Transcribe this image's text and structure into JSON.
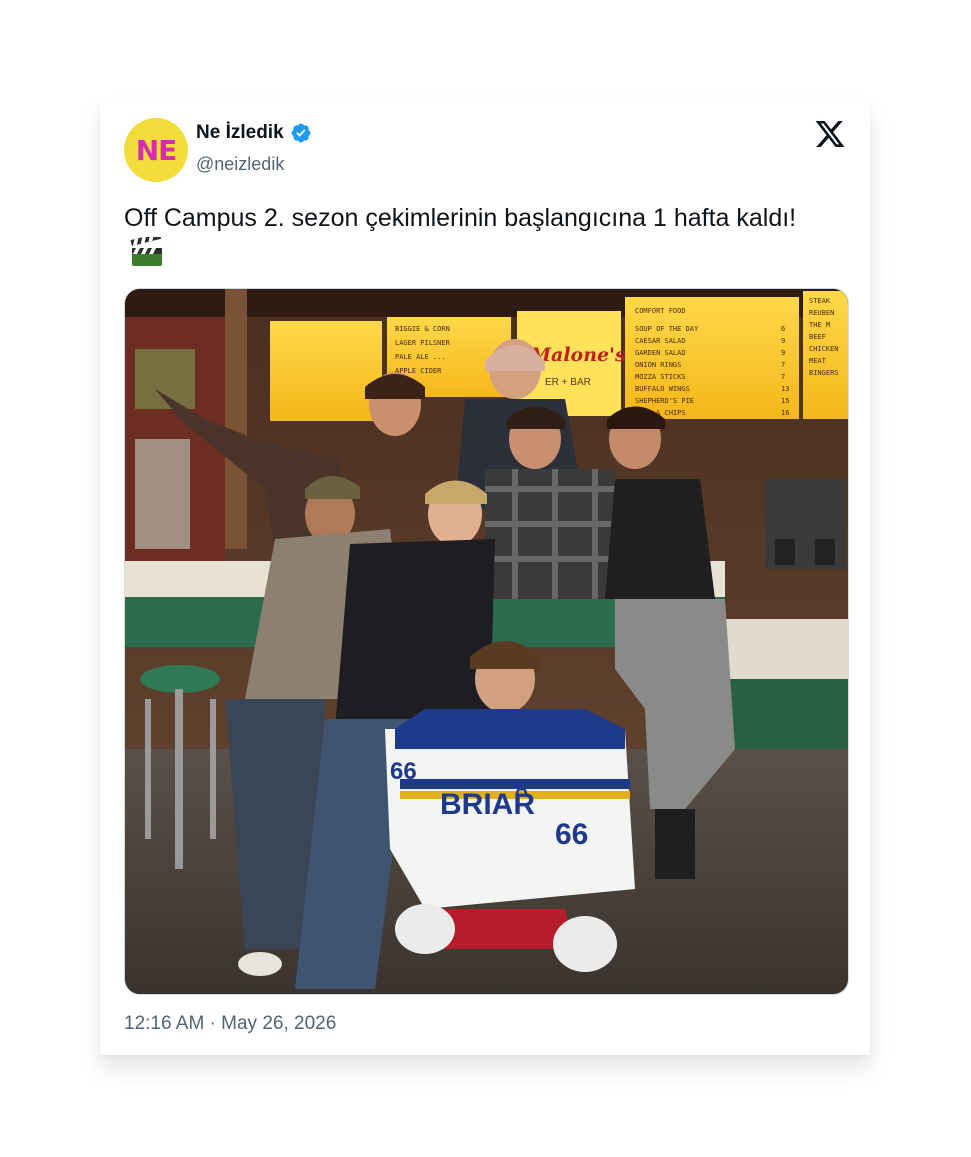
{
  "tweet": {
    "author": {
      "name": "Ne İzledik",
      "handle": "@neizledik",
      "avatar_text": "NE",
      "verified": true
    },
    "text": "Off Campus 2. sezon çekimlerinin başlangıcına 1 hafta kaldı!",
    "emoji": "clapper-board",
    "timestamp": "12:16 AM · May 26, 2026"
  },
  "photo": {
    "menu_left": [
      "BIGGIE & CORN",
      "LAGER PILSNER",
      "PALE ALE ...",
      "APPLE CIDER"
    ],
    "menu_sign": "Malone's",
    "menu_sign_sub": "ER + BAR",
    "menu_board_title": "COMFORT FOOD",
    "menu_board_items": [
      {
        "item": "SOUP OF THE DAY",
        "price": "6"
      },
      {
        "item": "CAESAR SALAD",
        "price": "9"
      },
      {
        "item": "GARDEN SALAD",
        "price": "9"
      },
      {
        "item": "ONION RINGS",
        "price": "7"
      },
      {
        "item": "MOZZA STICKS",
        "price": "7"
      },
      {
        "item": "BUFFALO WINGS",
        "price": "13"
      },
      {
        "item": "SHEPHERD'S PIE",
        "price": "15"
      },
      {
        "item": "FISH & CHIPS",
        "price": "16"
      }
    ],
    "menu_right_items": [
      "STEAK",
      "REUBEN",
      "THE M",
      "BEEF",
      "CHICKEN",
      "MEAT",
      "BINGERS"
    ],
    "jersey_text": "BRIAR",
    "jersey_number": "66",
    "jersey_letter": "A"
  },
  "colors": {
    "verified_blue": "#1d9bf0",
    "text_primary": "#0f1419",
    "text_secondary": "#536471",
    "avatar_bg": "#f2dd3a",
    "avatar_fg": "#d42ea8"
  }
}
